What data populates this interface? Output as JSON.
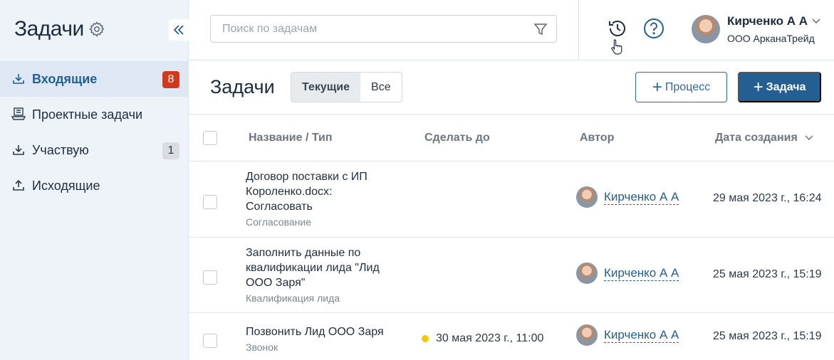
{
  "sidebar": {
    "title": "Задачи",
    "items": [
      {
        "label": "Входящие",
        "badge": "8",
        "icon": "inbox-icon"
      },
      {
        "label": "Проектные задачи",
        "badge": "",
        "icon": "project-tasks-icon"
      },
      {
        "label": "Участвую",
        "badge": "1",
        "icon": "participate-icon"
      },
      {
        "label": "Исходящие",
        "badge": "",
        "icon": "outbox-icon"
      }
    ]
  },
  "topbar": {
    "search_placeholder": "Поиск по задачам",
    "user_name": "Кирченко А А",
    "user_org": "ООО АрканаТрейд"
  },
  "header": {
    "title": "Задачи",
    "tabs": [
      "Текущие",
      "Все"
    ],
    "active_tab": "Текущие",
    "process_button": "Процесс",
    "task_button": "Задача"
  },
  "table": {
    "columns": [
      "Название / Тип",
      "Сделать до",
      "Автор",
      "Дата создания"
    ],
    "rows": [
      {
        "title": "Договор поставки с ИП Короленко.docx: Согласовать",
        "type": "Согласование",
        "due": "",
        "author": "Кирченко А А",
        "created": "29 мая 2023 г., 16:24"
      },
      {
        "title": "Заполнить данные по квалификации лида \"Лид ООО Заря\"",
        "type": "Квалификация лида",
        "due": "",
        "author": "Кирченко А А",
        "created": "25 мая 2023 г., 15:19"
      },
      {
        "title": "Позвонить Лид ООО Заря",
        "type": "Звонок",
        "due": "30 мая 2023 г., 11:00",
        "author": "Кирченко А А",
        "created": "25 мая 2023 г., 15:19"
      }
    ]
  },
  "colors": {
    "accent": "#235f92",
    "badge_red": "#d1391b",
    "due_dot": "#f3c800"
  }
}
